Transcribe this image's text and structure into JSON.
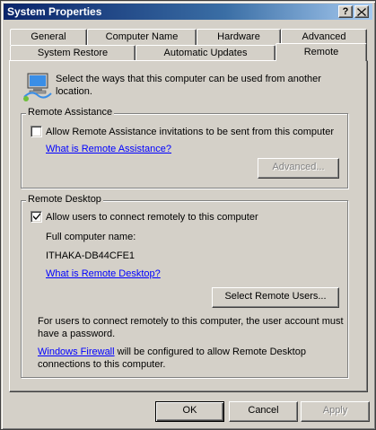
{
  "window": {
    "title": "System Properties",
    "help_button": "?",
    "close_button": "×"
  },
  "tabs": {
    "row1": [
      "General",
      "Computer Name",
      "Hardware",
      "Advanced"
    ],
    "row2": [
      "System Restore",
      "Automatic Updates",
      "Remote"
    ],
    "active": "Remote"
  },
  "intro": {
    "text_line1": "Select the ways that this computer can be used from another",
    "text_line2": "location.",
    "icon": "remote-computer-icon"
  },
  "remote_assistance": {
    "legend": "Remote Assistance",
    "checkbox_label": "Allow Remote Assistance invitations to be sent from this computer",
    "checked": false,
    "link": "What is Remote Assistance?",
    "advanced_button": "Advanced..."
  },
  "remote_desktop": {
    "legend": "Remote Desktop",
    "checkbox_label": "Allow users to connect remotely to this computer",
    "checked": true,
    "full_name_label": "Full computer name:",
    "computer_name": "ITHAKA-DB44CFE1",
    "link": "What is Remote Desktop?",
    "select_users_button": "Select Remote Users...",
    "note_line1": "For users to connect remotely to this computer, the user account must",
    "note_line2": "have a password.",
    "firewall_link": "Windows Firewall",
    "firewall_text_line1": " will be configured to allow Remote Desktop",
    "firewall_text_line2": "connections to this computer."
  },
  "footer": {
    "ok": "OK",
    "cancel": "Cancel",
    "apply": "Apply"
  },
  "colors": {
    "title_start": "#0a246a",
    "title_end": "#a6caf0",
    "face": "#d4d0c8",
    "link": "#0000ff"
  }
}
